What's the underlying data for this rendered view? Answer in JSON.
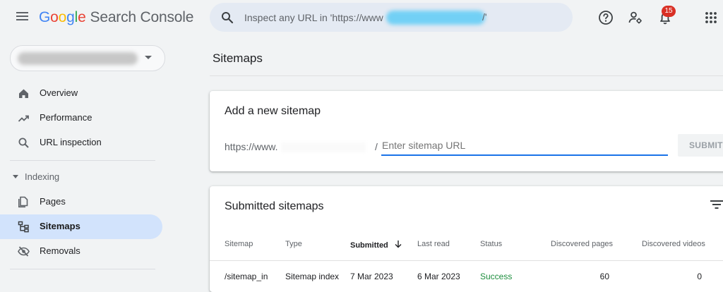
{
  "header": {
    "logo_letters": [
      "G",
      "o",
      "o",
      "g",
      "l",
      "e"
    ],
    "product_name": "Search Console",
    "search_placeholder": "Inspect any URL in 'https://www",
    "search_suffix": "/'",
    "notification_count": "15"
  },
  "sidebar": {
    "nav_top": [
      {
        "label": "Overview",
        "icon": "home-icon"
      },
      {
        "label": "Performance",
        "icon": "trending-up-icon"
      },
      {
        "label": "URL inspection",
        "icon": "search-icon"
      }
    ],
    "indexing_section": {
      "label": "Indexing",
      "items": [
        {
          "label": "Pages",
          "icon": "pages-icon"
        },
        {
          "label": "Sitemaps",
          "icon": "sitemap-icon",
          "active": true
        },
        {
          "label": "Removals",
          "icon": "eye-off-icon"
        }
      ]
    }
  },
  "main": {
    "page_title": "Sitemaps",
    "add_card": {
      "title": "Add a new sitemap",
      "url_prefix": "https://www.",
      "slash": "/",
      "input_placeholder": "Enter sitemap URL",
      "submit_label": "SUBMIT"
    },
    "submitted_card": {
      "title": "Submitted sitemaps",
      "columns": [
        "Sitemap",
        "Type",
        "Submitted",
        "Last read",
        "Status",
        "Discovered pages",
        "Discovered videos"
      ],
      "rows": [
        {
          "sitemap": "/sitemap_in",
          "type": "Sitemap index",
          "submitted": "7 Mar 2023",
          "last_read": "6 Mar 2023",
          "status": "Success",
          "pages": "60",
          "videos": "0"
        }
      ]
    }
  },
  "colors": {
    "accent_blue": "#1a73e8",
    "active_nav_bg": "#d2e3fc",
    "success_green": "#1e8e3e",
    "badge_red": "#d93025"
  }
}
